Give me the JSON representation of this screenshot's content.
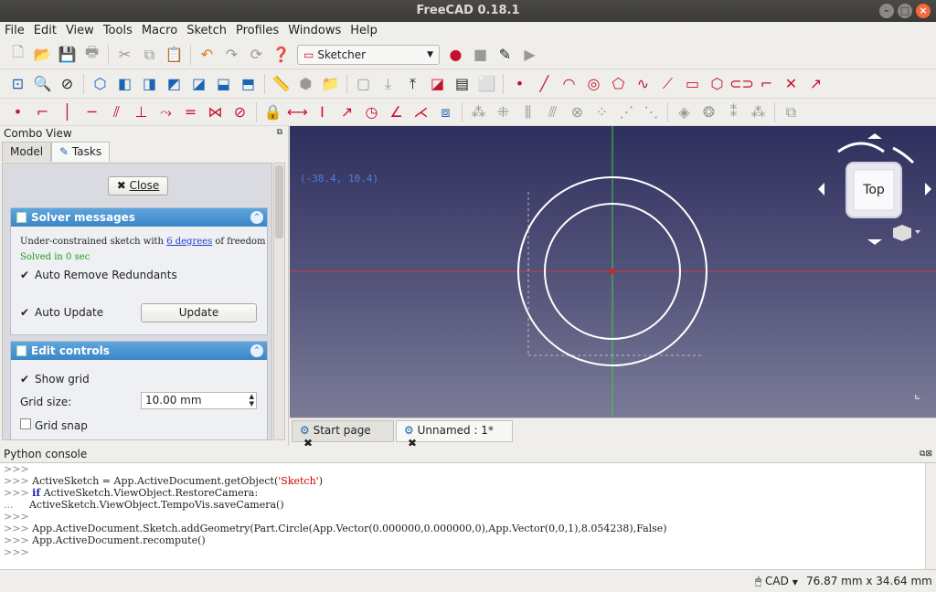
{
  "window": {
    "title": "FreeCAD 0.18.1"
  },
  "menu": [
    "File",
    "Edit",
    "View",
    "Tools",
    "Macro",
    "Sketch",
    "Profiles",
    "Windows",
    "Help"
  ],
  "toolbar": {
    "workbench": "Sketcher"
  },
  "combo": {
    "title": "Combo View",
    "tabs": [
      "Model",
      "Tasks"
    ],
    "close_label": "Close",
    "solver": {
      "title": "Solver messages",
      "msg_prefix": "Under-constrained sketch with ",
      "msg_link": "6 degrees",
      "msg_suffix": " of freedom",
      "solved": "Solved in 0 sec",
      "auto_remove": "Auto Remove Redundants",
      "auto_update": "Auto Update",
      "update_label": "Update"
    },
    "edit": {
      "title": "Edit controls",
      "show_grid": "Show grid",
      "grid_size_label": "Grid size:",
      "grid_size_value": "10.00 mm",
      "grid_snap": "Grid snap"
    }
  },
  "view": {
    "coords": "(-38.4, 10.4)",
    "cube_face": "Top"
  },
  "doc_tabs": [
    "Start page",
    "Unnamed : 1*"
  ],
  "console": {
    "title": "Python console",
    "lines": [
      {
        "prompt": ">>> ",
        "code": ""
      },
      {
        "prompt": ">>> ",
        "code": "ActiveSketch = App.ActiveDocument.getObject(",
        "str": "'Sketch'",
        "end": ")"
      },
      {
        "prompt": ">>> ",
        "kw": "if",
        "code": " ActiveSketch.ViewObject.RestoreCamera:"
      },
      {
        "prompt": "...     ",
        "code": "ActiveSketch.ViewObject.TempoVis.saveCamera()"
      },
      {
        "prompt": ">>> ",
        "code": ""
      },
      {
        "prompt": ">>> ",
        "code": "App.ActiveDocument.Sketch.addGeometry(Part.Circle(App.Vector(0.000000,0.000000,0),App.Vector(0,0,1),8.054238),False)"
      },
      {
        "prompt": ">>> ",
        "code": "App.ActiveDocument.recompute()"
      },
      {
        "prompt": ">>> ",
        "code": ""
      }
    ]
  },
  "status": {
    "nav": "CAD",
    "dims": "76.87 mm x 34.64 mm"
  }
}
